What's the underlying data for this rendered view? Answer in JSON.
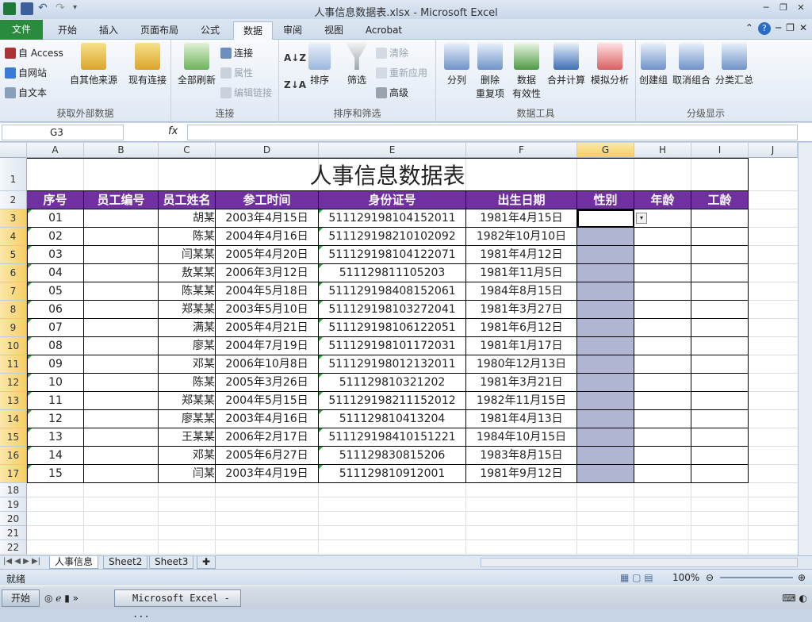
{
  "window": {
    "title": "人事信息数据表.xlsx - Microsoft Excel"
  },
  "tabs": [
    "文件",
    "开始",
    "插入",
    "页面布局",
    "公式",
    "数据",
    "审阅",
    "视图",
    "Acrobat"
  ],
  "ribbon": {
    "ext": {
      "access": "自 Access",
      "web": "自网站",
      "text": "自文本",
      "other": "自其他来源",
      "existing": "现有连接",
      "label": "获取外部数据"
    },
    "conn": {
      "refresh": "全部刷新",
      "connections": "连接",
      "props": "属性",
      "edit": "编辑链接",
      "label": "连接"
    },
    "sort": {
      "sort": "排序",
      "filter": "筛选",
      "clear": "清除",
      "reapply": "重新应用",
      "advanced": "高级",
      "label": "排序和筛选"
    },
    "tools": {
      "split": "分列",
      "dedupe1": "删除",
      "dedupe2": "重复项",
      "valid1": "数据",
      "valid2": "有效性",
      "merge": "合并计算",
      "whatif": "模拟分析",
      "label": "数据工具"
    },
    "outline": {
      "group": "创建组",
      "ungroup": "取消组合",
      "subtotal": "分类汇总",
      "label": "分级显示"
    }
  },
  "formula": {
    "namebox": "G3",
    "fx": "fx",
    "value": ""
  },
  "columns": [
    "A",
    "B",
    "C",
    "D",
    "E",
    "F",
    "G",
    "H",
    "I",
    "J"
  ],
  "sheet": {
    "title": "人事信息数据表",
    "headers": [
      "序号",
      "员工编号",
      "员工姓名",
      "参工时间",
      "身份证号",
      "出生日期",
      "性别",
      "年龄",
      "工龄"
    ],
    "rows": [
      [
        "01",
        "",
        "胡某",
        "2003年4月15日",
        "511129198104152011",
        "1981年4月15日"
      ],
      [
        "02",
        "",
        "陈某",
        "2004年4月16日",
        "511129198210102092",
        "1982年10月10日"
      ],
      [
        "03",
        "",
        "闫某某",
        "2005年4月20日",
        "511129198104122071",
        "1981年4月12日"
      ],
      [
        "04",
        "",
        "敖某某",
        "2006年3月12日",
        "511129811105203",
        "1981年11月5日"
      ],
      [
        "05",
        "",
        "陈某某",
        "2004年5月18日",
        "511129198408152061",
        "1984年8月15日"
      ],
      [
        "06",
        "",
        "郑某某",
        "2003年5月10日",
        "511129198103272041",
        "1981年3月27日"
      ],
      [
        "07",
        "",
        "满某",
        "2005年4月21日",
        "511129198106122051",
        "1981年6月12日"
      ],
      [
        "08",
        "",
        "廖某",
        "2004年7月19日",
        "511129198101172031",
        "1981年1月17日"
      ],
      [
        "09",
        "",
        "邓某",
        "2006年10月8日",
        "511129198012132011",
        "1980年12月13日"
      ],
      [
        "10",
        "",
        "陈某",
        "2005年3月26日",
        "511129810321202",
        "1981年3月21日"
      ],
      [
        "11",
        "",
        "郑某某",
        "2004年5月15日",
        "511129198211152012",
        "1982年11月15日"
      ],
      [
        "12",
        "",
        "廖某某",
        "2003年4月16日",
        "511129810413204",
        "1981年4月13日"
      ],
      [
        "13",
        "",
        "王某某",
        "2006年2月17日",
        "511129198410151221",
        "1984年10月15日"
      ],
      [
        "14",
        "",
        "邓某",
        "2005年6月27日",
        "511129830815206",
        "1983年8月15日"
      ],
      [
        "15",
        "",
        "闫某",
        "2003年4月19日",
        "511129810912001",
        "1981年9月12日"
      ]
    ]
  },
  "sheet_tabs": [
    "人事信息",
    "Sheet2",
    "Sheet3"
  ],
  "status": {
    "ready": "就绪",
    "zoom": "100%"
  },
  "taskbar": {
    "start": "开始",
    "excel": "Microsoft Excel - ..."
  },
  "colors": {
    "header_bg": "#7030a0",
    "selection": "#b0b6d1",
    "file_tab": "#2a8a3e"
  }
}
